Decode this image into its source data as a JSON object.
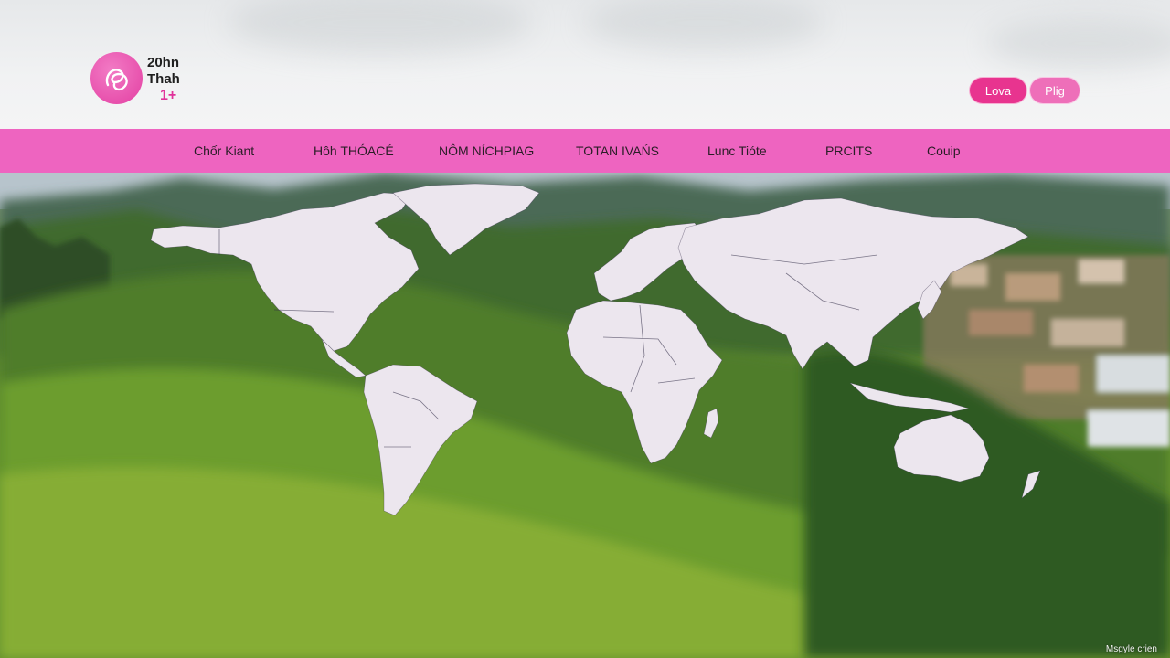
{
  "brand": {
    "line1": "20hn",
    "line2": "Thah",
    "line3": "1+",
    "logo_icon": "stylized-swirl-icon",
    "accent_color": "#e8348f"
  },
  "header_buttons": {
    "primary": "Lova",
    "secondary": "Plig"
  },
  "nav": {
    "items": [
      "Chốr Kiant",
      "Hôh THÓACÉ",
      "NÔM NÍCHPIAG",
      "TOTAN IVAŃS",
      "Lunc Tióte",
      "PRCITS",
      "Couip"
    ],
    "background_color": "#ee64c0"
  },
  "hero": {
    "image": "world-map-over-mountain-landscape",
    "credit": "Msgyle crien"
  }
}
